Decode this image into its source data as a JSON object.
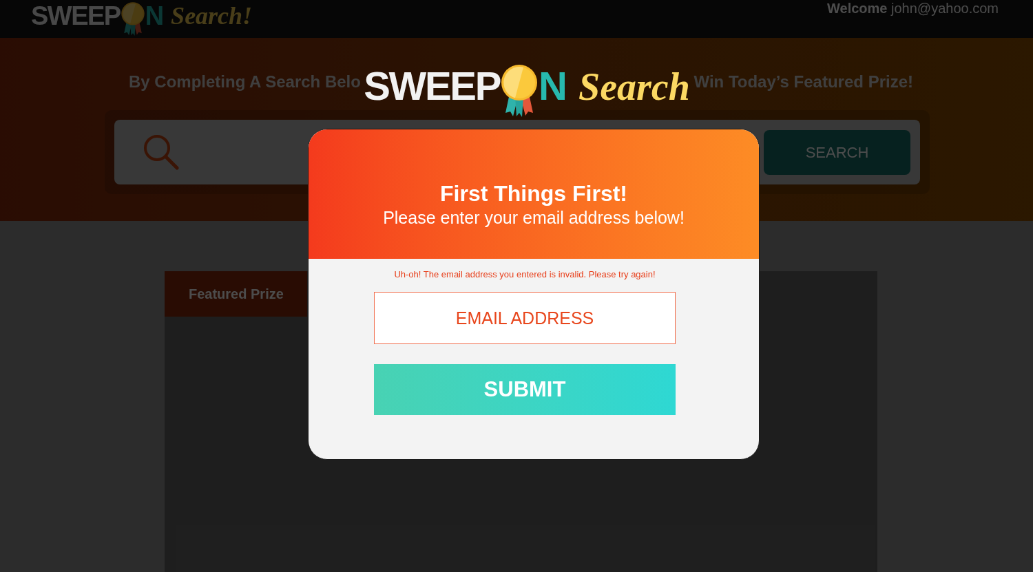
{
  "header": {
    "logo": {
      "word": "SWEEP",
      "letter": "N",
      "script": "Search!"
    },
    "welcome": "**Welcome** john@yahoo.com"
  },
  "banner": {
    "headline_fragments": [
      "By Completing A Search Belo",
      "Win Today’s Featured Prize!"
    ],
    "search_button": "SEARCH"
  },
  "featured": {
    "tab": "Featured Prize"
  },
  "modal": {
    "logo": {
      "word": "SWEEP",
      "letter": "N",
      "script": "Search"
    },
    "title": "First Things First!",
    "subtitle": "Please enter your email address below!",
    "error": "Uh-oh! The email address you entered is invalid. Please try again!",
    "email_field": {
      "placeholder": "EMAIL ADDRESS",
      "invalid": true
    },
    "submit": "SUBMIT"
  }
}
